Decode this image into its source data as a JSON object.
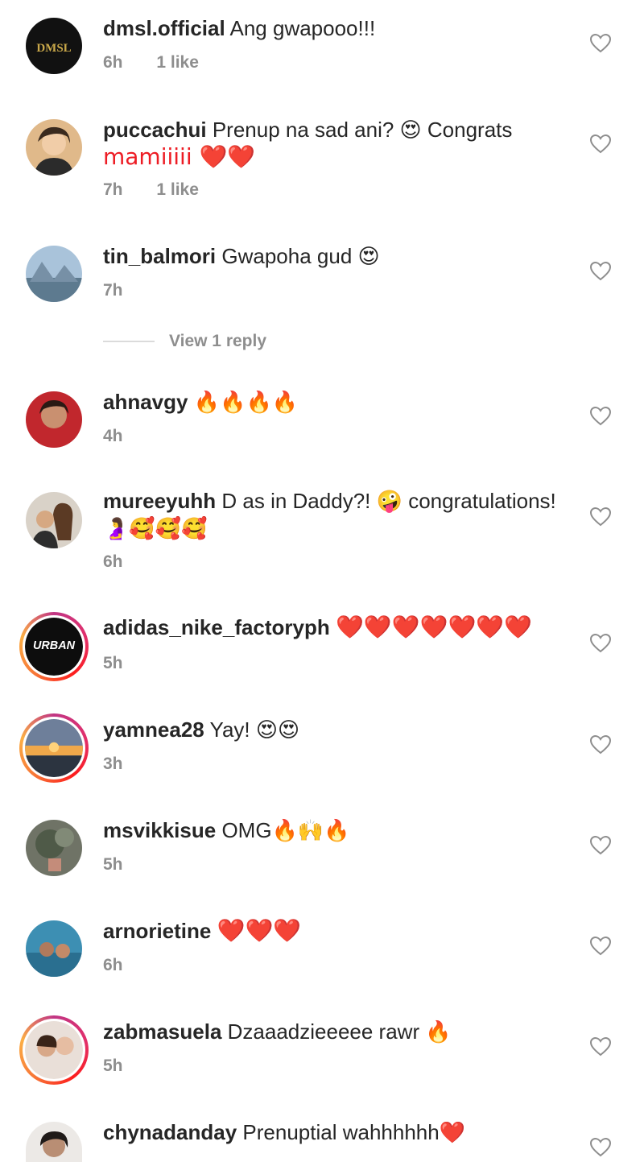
{
  "comments": [
    {
      "user": "dmsl.official",
      "text": "Ang gwapooo!!!",
      "time": "6h",
      "likes": "1 like"
    },
    {
      "user": "puccachui",
      "text": "Prenup na sad ani? 😍 Congrats",
      "text2": "mamiiiii ❤️❤️",
      "time": "7h",
      "likes": "1 like"
    },
    {
      "user": "tin_balmori",
      "text": "Gwapoha gud 😍",
      "time": "7h"
    },
    {
      "user": "ahnavgy",
      "text": "🔥🔥🔥🔥",
      "time": "4h"
    },
    {
      "user": "mureeyuhh",
      "text": "D as in Daddy?! 🤪 congratulations!",
      "text2": "🤰🥰🥰🥰",
      "time": "6h"
    },
    {
      "user": "adidas_nike_factoryph",
      "text": "❤️❤️❤️❤️❤️❤️❤️",
      "time": "5h"
    },
    {
      "user": "yamnea28",
      "text": "Yay! 😍😍",
      "time": "3h"
    },
    {
      "user": "msvikkisue",
      "text": "OMG🔥🙌🔥",
      "time": "5h"
    },
    {
      "user": "arnorietine",
      "text": "❤️❤️❤️",
      "time": "6h"
    },
    {
      "user": "zabmasuela",
      "text": "Dzaaadzieeeee rawr 🔥",
      "time": "5h"
    },
    {
      "user": "chynadanday",
      "text": "Prenuptial wahhhhhh❤️"
    }
  ],
  "view_reply": "View 1 reply",
  "avatar_logos": {
    "dmsl": "DMSL",
    "urban": "URBAN"
  }
}
